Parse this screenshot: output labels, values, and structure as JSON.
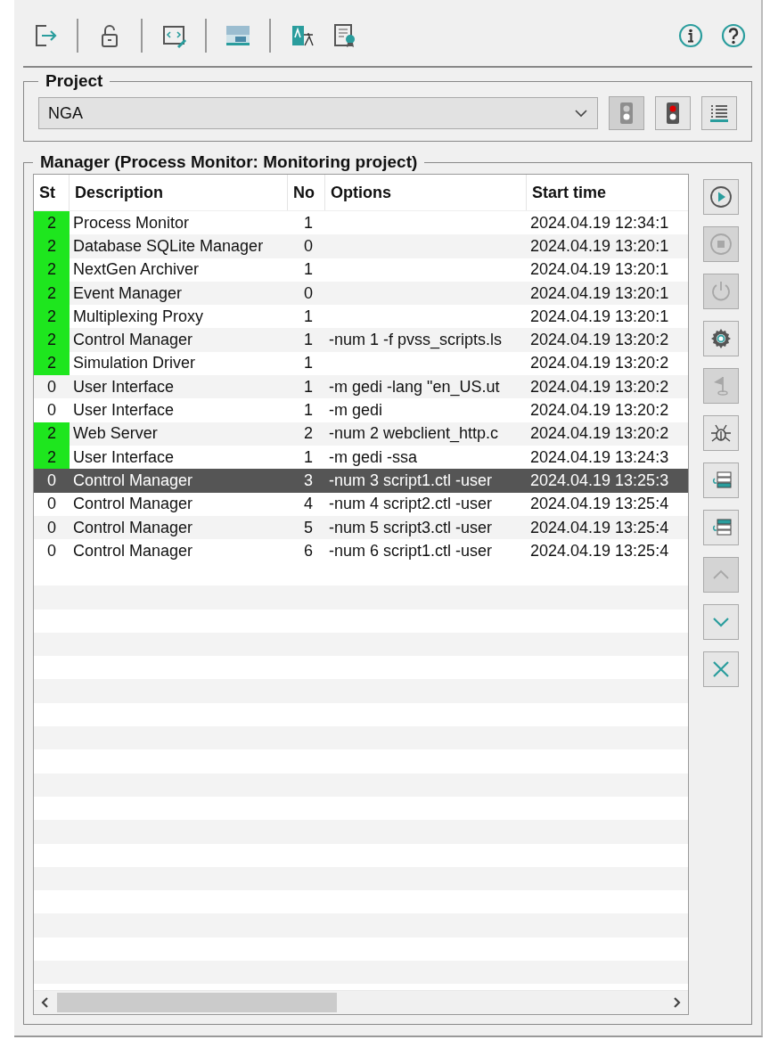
{
  "toolbar": {
    "buttons": [
      {
        "kind": "exit"
      },
      {
        "kind": "separator"
      },
      {
        "kind": "unlock"
      },
      {
        "kind": "separator"
      },
      {
        "kind": "script"
      },
      {
        "kind": "separator"
      },
      {
        "kind": "logo"
      },
      {
        "kind": "separator"
      },
      {
        "kind": "translate"
      },
      {
        "kind": "certificate"
      }
    ],
    "help_buttons": [
      {
        "kind": "info"
      },
      {
        "kind": "help"
      }
    ]
  },
  "project": {
    "title": "Project",
    "value": "NGA",
    "buttons": [
      {
        "kind": "light-off",
        "disabled": true
      },
      {
        "kind": "light-red",
        "disabled": false
      },
      {
        "kind": "list",
        "disabled": false
      }
    ]
  },
  "manager": {
    "title": "Manager  (Process Monitor: Monitoring project)",
    "columns": [
      "St",
      "Description",
      "No",
      "Options",
      "Start time"
    ],
    "rows": [
      {
        "st": "2",
        "running": true,
        "description": "Process Monitor",
        "no": "1",
        "options": "",
        "start_time": "2024.04.19 12:34:1",
        "selected": false
      },
      {
        "st": "2",
        "running": true,
        "description": "Database SQLite Manager",
        "no": "0",
        "options": "",
        "start_time": "2024.04.19 13:20:1",
        "selected": false
      },
      {
        "st": "2",
        "running": true,
        "description": "NextGen Archiver",
        "no": "1",
        "options": "",
        "start_time": "2024.04.19 13:20:1",
        "selected": false
      },
      {
        "st": "2",
        "running": true,
        "description": "Event Manager",
        "no": "0",
        "options": "",
        "start_time": "2024.04.19 13:20:1",
        "selected": false
      },
      {
        "st": "2",
        "running": true,
        "description": "Multiplexing Proxy",
        "no": "1",
        "options": "",
        "start_time": "2024.04.19 13:20:1",
        "selected": false
      },
      {
        "st": "2",
        "running": true,
        "description": "Control Manager",
        "no": "1",
        "options": "-num 1 -f pvss_scripts.ls",
        "start_time": "2024.04.19 13:20:2",
        "selected": false
      },
      {
        "st": "2",
        "running": true,
        "description": "Simulation Driver",
        "no": "1",
        "options": "",
        "start_time": "2024.04.19 13:20:2",
        "selected": false
      },
      {
        "st": "0",
        "running": false,
        "description": "User Interface",
        "no": "1",
        "options": "-m gedi -lang  \"en_US.ut",
        "start_time": "2024.04.19 13:20:2",
        "selected": false
      },
      {
        "st": "0",
        "running": false,
        "description": "User Interface",
        "no": "1",
        "options": "-m gedi",
        "start_time": "2024.04.19 13:20:2",
        "selected": false
      },
      {
        "st": "2",
        "running": true,
        "description": "Web Server",
        "no": "2",
        "options": "-num 2 webclient_http.c",
        "start_time": "2024.04.19 13:20:2",
        "selected": false
      },
      {
        "st": "2",
        "running": true,
        "description": "User Interface",
        "no": "1",
        "options": "-m gedi -ssa",
        "start_time": "2024.04.19 13:24:3",
        "selected": false
      },
      {
        "st": "0",
        "running": false,
        "description": "Control Manager",
        "no": "3",
        "options": "-num 3 script1.ctl -user",
        "start_time": "2024.04.19 13:25:3",
        "selected": true
      },
      {
        "st": "0",
        "running": false,
        "description": "Control Manager",
        "no": "4",
        "options": "-num 4 script2.ctl -user",
        "start_time": "2024.04.19 13:25:4",
        "selected": false
      },
      {
        "st": "0",
        "running": false,
        "description": "Control Manager",
        "no": "5",
        "options": "-num 5 script3.ctl -user",
        "start_time": "2024.04.19 13:25:4",
        "selected": false
      },
      {
        "st": "0",
        "running": false,
        "description": "Control Manager",
        "no": "6",
        "options": "-num 6 script1.ctl -user",
        "start_time": "2024.04.19 13:25:4",
        "selected": false
      }
    ],
    "side_buttons": [
      {
        "kind": "play",
        "disabled": false
      },
      {
        "kind": "stop",
        "disabled": true
      },
      {
        "kind": "power",
        "disabled": true
      },
      {
        "kind": "gear",
        "disabled": false
      },
      {
        "kind": "flag",
        "disabled": true
      },
      {
        "kind": "bug",
        "disabled": false
      },
      {
        "kind": "insert-below",
        "disabled": false
      },
      {
        "kind": "insert-above",
        "disabled": false
      },
      {
        "kind": "up",
        "disabled": true
      },
      {
        "kind": "down",
        "disabled": false
      },
      {
        "kind": "close",
        "disabled": false
      }
    ]
  }
}
